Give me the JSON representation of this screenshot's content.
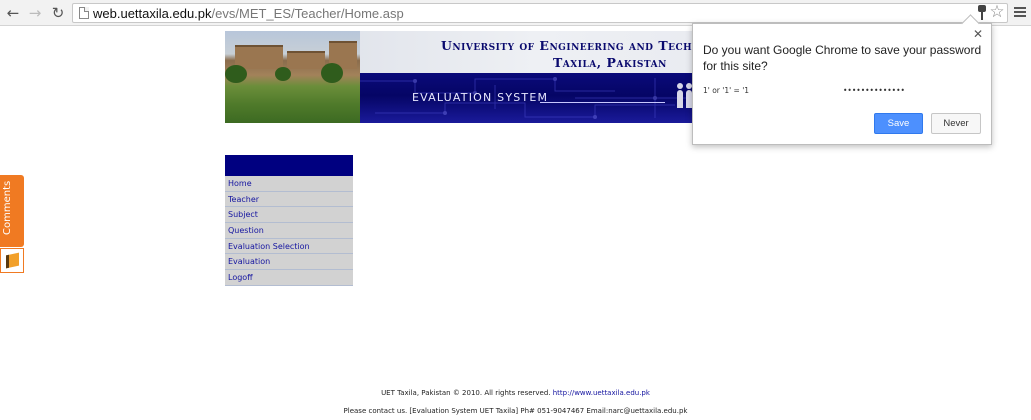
{
  "browser": {
    "url_domain": "web.uettaxila.edu.pk",
    "url_path": "/evs/MET_ES/Teacher/Home.asp",
    "icons": [
      "back-arrow-icon",
      "forward-arrow-icon",
      "reload-icon",
      "page-icon",
      "key-icon",
      "star-icon",
      "menu-icon"
    ]
  },
  "banner": {
    "university": "University of Engineering and Tech",
    "city": "Taxila, Pakistan",
    "system": "EVALUATION SYSTEM"
  },
  "menu": {
    "items": [
      "Home",
      "Teacher",
      "Subject",
      "Question",
      "Evaluation Selection",
      "Evaluation",
      "Logoff"
    ],
    "header_color": "#000080",
    "item_bg": "#d2d2d2",
    "link_color": "#1515a0"
  },
  "comments": {
    "label": "Comments",
    "color": "#f07a22"
  },
  "password_bubble": {
    "title": "Do you want Google Chrome to save your password for this site?",
    "username": "1' or '1' = '1",
    "password": "••••••••••••••",
    "save_label": "Save",
    "never_label": "Never",
    "save_color": "#4d90fe"
  },
  "footer": {
    "line1_text": "UET Taxila, Pakistan © 2010. All rights reserved. ",
    "line1_link": "http://www.uettaxila.edu.pk",
    "line2": "Please contact us. [Evaluation System UET Taxila] Ph# 051-9047467 Email:narc@uettaxila.edu.pk"
  }
}
